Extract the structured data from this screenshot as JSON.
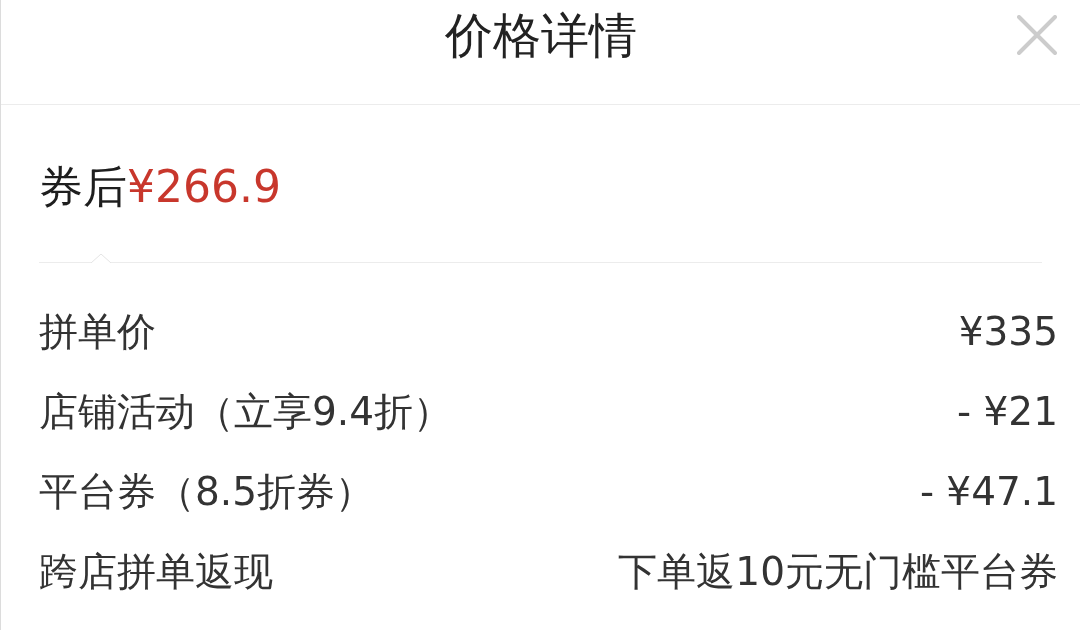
{
  "header": {
    "title": "价格详情"
  },
  "summary": {
    "label": "券后",
    "price": "¥266.9"
  },
  "rows": [
    {
      "label": "拼单价",
      "value": "¥335"
    },
    {
      "label": "店铺活动（立享9.4折）",
      "value": "- ¥21"
    },
    {
      "label": "平台券（8.5折券）",
      "value": "- ¥47.1"
    },
    {
      "label": "跨店拼单返现",
      "value": "下单返10元无门槛平台券"
    }
  ]
}
